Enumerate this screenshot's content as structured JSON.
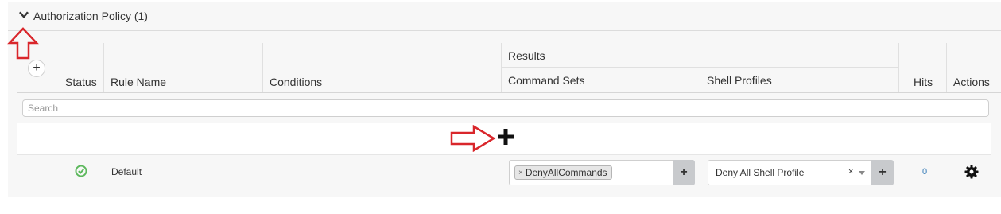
{
  "section": {
    "title": "Authorization Policy (1)",
    "toggle_icon": "chevron-down-icon"
  },
  "table": {
    "headers": {
      "status": "Status",
      "rule_name": "Rule Name",
      "conditions": "Conditions",
      "results": "Results",
      "command_sets": "Command Sets",
      "shell_profiles": "Shell Profiles",
      "hits": "Hits",
      "actions": "Actions"
    },
    "add_rule_icon": "plus-icon"
  },
  "search": {
    "placeholder": "Search"
  },
  "insert_row": {
    "icon": "plus-icon"
  },
  "rows": [
    {
      "status_icon": "check-circle-icon",
      "status_color": "#5cb85c",
      "rule_name": "Default",
      "command_sets": [
        "DenyAllCommands"
      ],
      "shell_profile": "Deny All Shell Profile",
      "hits": "0",
      "actions_icon": "gear-icon"
    }
  ],
  "annotations": {
    "arrow_color": "#d9262b"
  }
}
